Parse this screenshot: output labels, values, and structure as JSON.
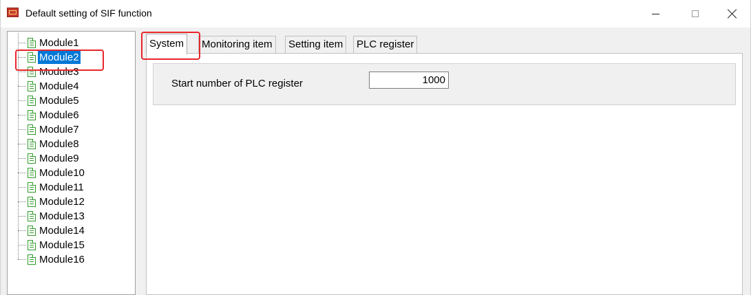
{
  "window": {
    "title": "Default setting of SIF function",
    "icon": "qtc-app-icon",
    "minimize_icon": "minimize-icon",
    "maximize_icon": "maximize-icon",
    "close_icon": "close-icon"
  },
  "tree": {
    "items": [
      {
        "label": "Module1"
      },
      {
        "label": "Module2",
        "selected": true
      },
      {
        "label": "Module3"
      },
      {
        "label": "Module4"
      },
      {
        "label": "Module5"
      },
      {
        "label": "Module6"
      },
      {
        "label": "Module7"
      },
      {
        "label": "Module8"
      },
      {
        "label": "Module9"
      },
      {
        "label": "Module10"
      },
      {
        "label": "Module11"
      },
      {
        "label": "Module12"
      },
      {
        "label": "Module13"
      },
      {
        "label": "Module14"
      },
      {
        "label": "Module15"
      },
      {
        "label": "Module16"
      }
    ],
    "item_icon": "document-icon"
  },
  "tabs": [
    {
      "label": "System",
      "active": true
    },
    {
      "label": "Monitoring item"
    },
    {
      "label": "Setting item"
    },
    {
      "label": "PLC register"
    }
  ],
  "system": {
    "start_label": "Start number of PLC register",
    "start_value": "1000"
  },
  "colors": {
    "selection": "#0078d7",
    "highlight": "#e8262b",
    "doc_icon": "#2e9a28"
  }
}
